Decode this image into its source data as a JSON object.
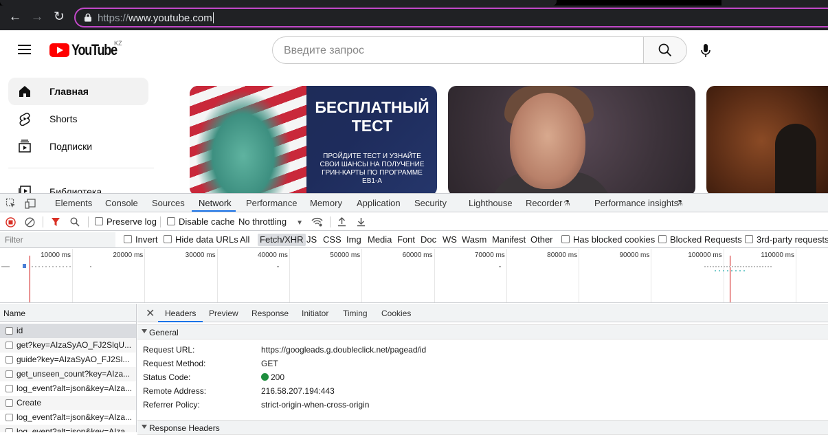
{
  "browser": {
    "url_scheme": "https://",
    "url_host": "www.youtube.com"
  },
  "youtube": {
    "logo_text": "YouTube",
    "country_code": "KZ",
    "search_placeholder": "Введите запрос",
    "sidebar": [
      {
        "label": "Главная",
        "icon": "home-icon",
        "active": true
      },
      {
        "label": "Shorts",
        "icon": "shorts-icon",
        "active": false
      },
      {
        "label": "Подписки",
        "icon": "subscriptions-icon",
        "active": false
      },
      {
        "label": "Библиотека",
        "icon": "library-icon",
        "active": false
      }
    ],
    "thumbnails": [
      {
        "title": "БЕСПЛАТНЫЙ ТЕСТ",
        "text": "ПРОЙДИТЕ ТЕСТ И УЗНАЙТЕ СВОИ ШАНСЫ НА ПОЛУЧЕНИЕ ГРИН-КАРТЫ ПО ПРОГРАММЕ EB1-A"
      }
    ]
  },
  "devtools": {
    "tabs": [
      "Elements",
      "Console",
      "Sources",
      "Network",
      "Performance",
      "Memory",
      "Application",
      "Security",
      "Lighthouse",
      "Recorder",
      "Performance insights"
    ],
    "selected_tab": "Network",
    "toolbar": {
      "preserve_log": "Preserve log",
      "disable_cache": "Disable cache",
      "throttling": "No throttling"
    },
    "filter": {
      "placeholder": "Filter",
      "invert": "Invert",
      "hide_data_urls": "Hide data URLs",
      "types": [
        "All",
        "Fetch/XHR",
        "JS",
        "CSS",
        "Img",
        "Media",
        "Font",
        "Doc",
        "WS",
        "Wasm",
        "Manifest",
        "Other"
      ],
      "selected_type": "Fetch/XHR",
      "has_blocked_cookies": "Has blocked cookies",
      "blocked_requests": "Blocked Requests",
      "third_party": "3rd-party requests"
    },
    "timeline_ticks": [
      "10000 ms",
      "20000 ms",
      "30000 ms",
      "40000 ms",
      "50000 ms",
      "60000 ms",
      "70000 ms",
      "80000 ms",
      "90000 ms",
      "100000 ms",
      "110000 ms"
    ],
    "name_header": "Name",
    "requests": [
      "id",
      "get?key=AIzaSyAO_FJ2SlqU...",
      "guide?key=AIzaSyAO_FJ2Sl...",
      "get_unseen_count?key=AIza...",
      "log_event?alt=json&key=AIza...",
      "Create",
      "log_event?alt=json&key=AIza...",
      "log_event?alt=json&key=AIza..."
    ],
    "detail_tabs": [
      "Headers",
      "Preview",
      "Response",
      "Initiator",
      "Timing",
      "Cookies"
    ],
    "selected_detail_tab": "Headers",
    "general_label": "General",
    "general": [
      {
        "key": "Request URL:",
        "value": "https://googleads.g.doubleclick.net/pagead/id"
      },
      {
        "key": "Request Method:",
        "value": "GET"
      },
      {
        "key": "Status Code:",
        "value": "200"
      },
      {
        "key": "Remote Address:",
        "value": "216.58.207.194:443"
      },
      {
        "key": "Referrer Policy:",
        "value": "strict-origin-when-cross-origin"
      }
    ],
    "response_headers_label": "Response Headers"
  }
}
